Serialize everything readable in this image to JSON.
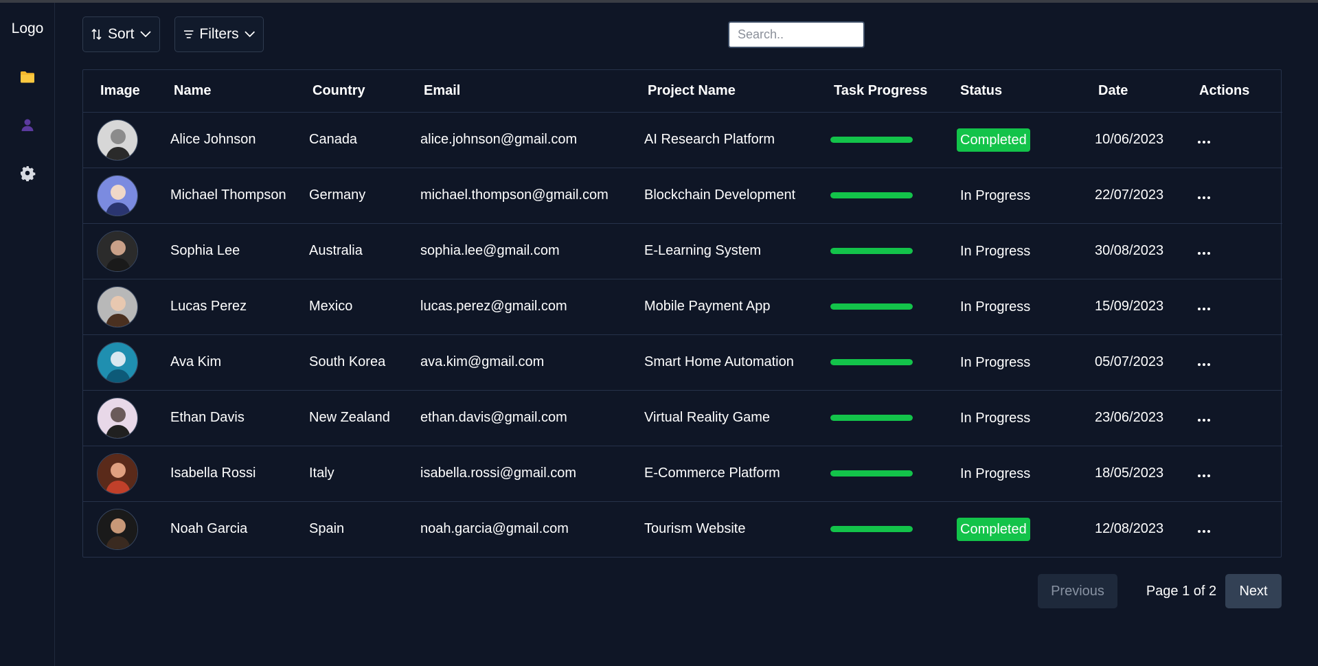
{
  "sidebar": {
    "logo": "Logo",
    "icons": [
      "folder-icon",
      "user-icon",
      "gear-icon"
    ]
  },
  "toolbar": {
    "sort_label": "Sort",
    "filters_label": "Filters",
    "search_placeholder": "Search..",
    "search_value": ""
  },
  "table": {
    "columns": [
      "Image",
      "Name",
      "Country",
      "Email",
      "Project Name",
      "Task Progress",
      "Status",
      "Date",
      "Actions"
    ],
    "rows": [
      {
        "name": "Alice Johnson",
        "country": "Canada",
        "email": "alice.johnson@gmail.com",
        "project": "AI Research Platform",
        "progress": 100,
        "status": "Completed",
        "date": "10/06/2023"
      },
      {
        "name": "Michael Thompson",
        "country": "Germany",
        "email": "michael.thompson@gmail.com",
        "project": "Blockchain Development",
        "progress": 100,
        "status": "In Progress",
        "date": "22/07/2023"
      },
      {
        "name": "Sophia Lee",
        "country": "Australia",
        "email": "sophia.lee@gmail.com",
        "project": "E-Learning System",
        "progress": 100,
        "status": "In Progress",
        "date": "30/08/2023"
      },
      {
        "name": "Lucas Perez",
        "country": "Mexico",
        "email": "lucas.perez@gmail.com",
        "project": "Mobile Payment App",
        "progress": 100,
        "status": "In Progress",
        "date": "15/09/2023"
      },
      {
        "name": "Ava Kim",
        "country": "South Korea",
        "email": "ava.kim@gmail.com",
        "project": "Smart Home Automation",
        "progress": 100,
        "status": "In Progress",
        "date": "05/07/2023"
      },
      {
        "name": "Ethan Davis",
        "country": "New Zealand",
        "email": "ethan.davis@gmail.com",
        "project": "Virtual Reality Game",
        "progress": 100,
        "status": "In Progress",
        "date": "23/06/2023"
      },
      {
        "name": "Isabella Rossi",
        "country": "Italy",
        "email": "isabella.rossi@gmail.com",
        "project": "E-Commerce Platform",
        "progress": 100,
        "status": "In Progress",
        "date": "18/05/2023"
      },
      {
        "name": "Noah Garcia",
        "country": "Spain",
        "email": "noah.garcia@gmail.com",
        "project": "Tourism Website",
        "progress": 100,
        "status": "Completed",
        "date": "12/08/2023"
      }
    ]
  },
  "pagination": {
    "previous_label": "Previous",
    "page_label": "Page 1 of 2",
    "next_label": "Next"
  },
  "colors": {
    "background": "#0f1626",
    "accent_green": "#13c34a",
    "folder_icon": "#f5b82e",
    "user_icon": "#5b3a9e",
    "border": "#26324a"
  }
}
